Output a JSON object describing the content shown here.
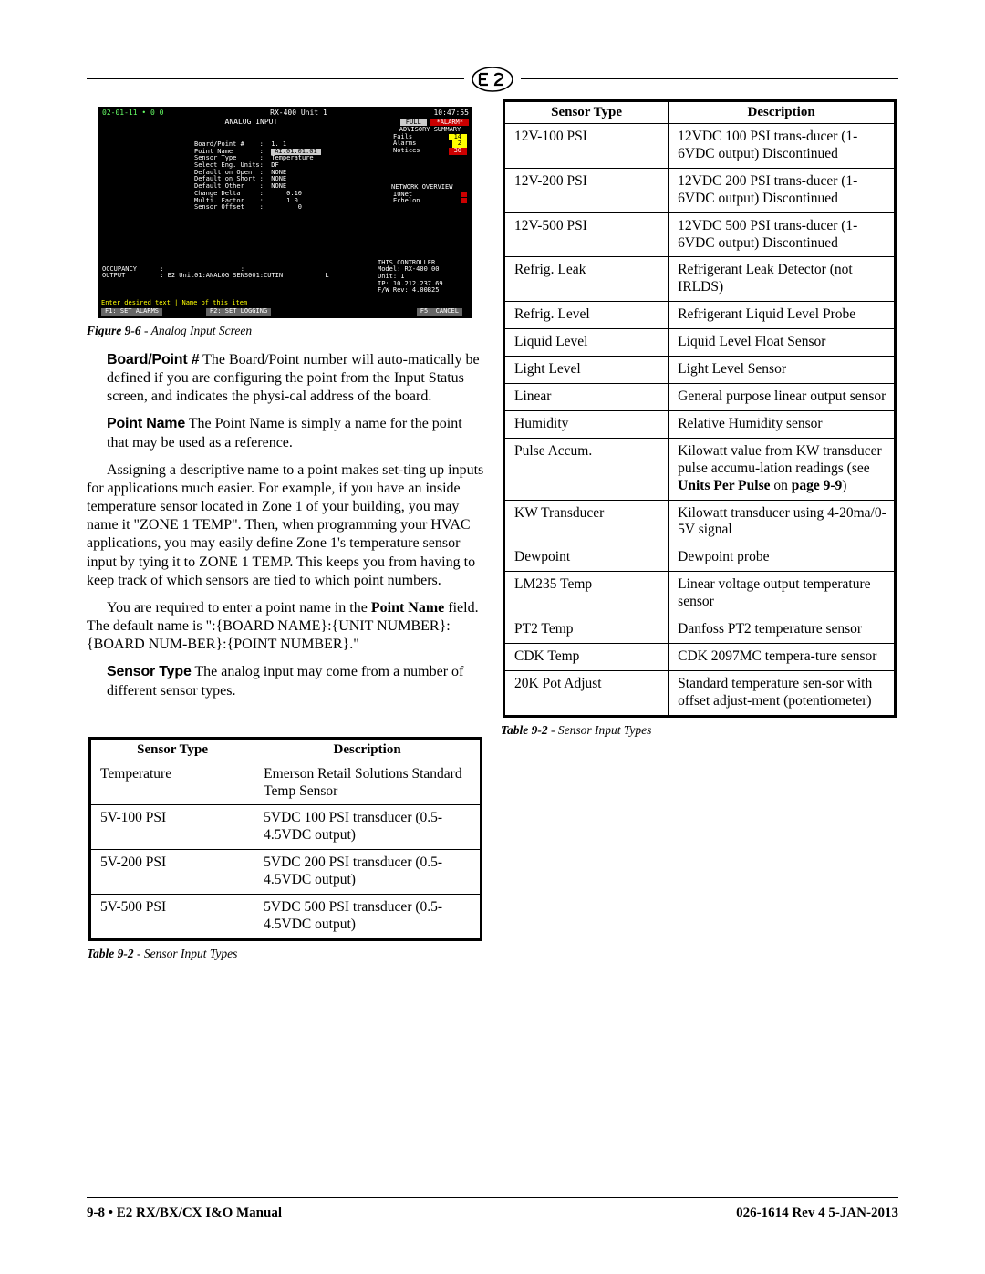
{
  "header": {
    "logo_text": "E2"
  },
  "screenshot": {
    "top_left": "02-01-11 • 0 0",
    "top_mid": "RX-400 Unit 1",
    "top_right": "10:47:55",
    "analog_title": "ANALOG INPUT",
    "full": "FULL",
    "oalarm": "*ALARM*",
    "advisory": "ADVISORY SUMMARY",
    "adv_rows": [
      {
        "l": "Fails",
        "v": "14"
      },
      {
        "l": "Alarms",
        "v": "2"
      },
      {
        "l": "Notices",
        "v": "30"
      }
    ],
    "fields": [
      "Board/Point #    :  1. 1",
      "Point Name       :  ",
      "Sensor Type      :  Temperature",
      "Select Eng. Units:  DF",
      "Default on Open  :  NONE",
      "Default on Short :  NONE",
      "Default Other    :  NONE",
      "Change Delta     :      0.10",
      "",
      "Multi. Factor    :      1.0",
      "Sensor Offset    :         0"
    ],
    "point_name_val": "AI.01.01.01",
    "net_over_title": "NETWORK OVERVIEW",
    "net_rows": [
      {
        "l": "IONet"
      },
      {
        "l": "Echelon"
      }
    ],
    "controller_title": "THIS CONTROLLER",
    "controller_rows": [
      "Model: RX-400    00",
      "Unit: 1",
      "IP: 10.212.237.69",
      "F/W Rev: 4.00B25"
    ],
    "occ_rows": [
      "OCCUPANCY      :                    :",
      "OUTPUT         : E2 Unit01:ANALOG SENS001:CUTIN           L"
    ],
    "enter": "Enter desired text | Name of this item",
    "fkeys": [
      "F1: SET ALARMS",
      "F2: SET LOGGING",
      "",
      "",
      "F5: CANCEL"
    ]
  },
  "fig_caption": {
    "label": "Figure 9-6",
    "title": " - Analog Input Screen"
  },
  "paras": {
    "board_point_lead": "Board/Point #",
    "board_point": "   The Board/Point number will auto-matically be defined if you are configuring the point from the Input Status screen, and indicates the physi-cal address of the board.",
    "point_name_lead": "Point Name",
    "point_name": "   The Point Name is simply a name for the point that may be used as a reference.",
    "assign": "Assigning a descriptive name to a point makes set-ting up inputs for applications much easier. For example, if you have an inside temperature sensor located in Zone 1 of your building, you may name it \"ZONE 1 TEMP\". Then, when programming your HVAC applications, you may easily define Zone 1's temperature sensor input by tying it to ZONE 1 TEMP. This keeps you from having to keep track of which sensors are tied to which point numbers.",
    "required1": "You are required to enter a point name in the ",
    "required_b1": "Point Name",
    "required2": " field. The default name is \":{BOARD NAME}:{UNIT NUMBER}:{BOARD NUM-BER}:{POINT NUMBER}.\"",
    "sensor_type_lead": "Sensor Type",
    "sensor_type": "   The analog input may come from a number of different sensor types."
  },
  "table_header": {
    "col1": "Sensor Type",
    "col2": "Description"
  },
  "table1_rows": [
    {
      "type": "Temperature",
      "desc": "Emerson Retail Solutions Standard Temp Sensor"
    },
    {
      "type": "5V-100 PSI",
      "desc": "5VDC 100 PSI transducer (0.5-4.5VDC output)"
    },
    {
      "type": "5V-200 PSI",
      "desc": "5VDC 200 PSI transducer (0.5-4.5VDC output)"
    },
    {
      "type": "5V-500 PSI",
      "desc": "5VDC 500 PSI transducer (0.5-4.5VDC output)"
    }
  ],
  "table2_rows": [
    {
      "type": "12V-100 PSI",
      "desc": "12VDC 100 PSI trans-ducer (1-6VDC output) Discontinued"
    },
    {
      "type": "12V-200 PSI",
      "desc": "12VDC 200 PSI trans-ducer (1-6VDC output) Discontinued"
    },
    {
      "type": "12V-500 PSI",
      "desc": "12VDC 500 PSI trans-ducer (1-6VDC output) Discontinued"
    },
    {
      "type": "Refrig. Leak",
      "desc": "Refrigerant Leak Detector (not IRLDS)"
    },
    {
      "type": "Refrig. Level",
      "desc": "Refrigerant Liquid Level Probe"
    },
    {
      "type": "Liquid Level",
      "desc": "Liquid Level Float Sensor"
    },
    {
      "type": "Light Level",
      "desc": "Light Level Sensor"
    },
    {
      "type": "Linear",
      "desc": "General purpose linear output sensor"
    },
    {
      "type": "Humidity",
      "desc": "Relative Humidity sensor"
    },
    {
      "type": "Pulse Accum.",
      "desc_html": true,
      "desc": "Kilowatt value from KW transducer pulse accumu-lation readings (see <b>Units Per Pulse</b> on <b>page 9-9</b>)"
    },
    {
      "type": "KW Transducer",
      "desc": "Kilowatt transducer using 4-20ma/0-5V signal"
    },
    {
      "type": "Dewpoint",
      "desc": "Dewpoint probe"
    },
    {
      "type": "LM235 Temp",
      "desc": "Linear voltage output temperature sensor"
    },
    {
      "type": "PT2 Temp",
      "desc": "Danfoss PT2 temperature sensor"
    },
    {
      "type": "CDK Temp",
      "desc": "CDK 2097MC tempera-ture sensor"
    },
    {
      "type": "20K Pot Adjust",
      "desc": "Standard temperature sen-sor with offset adjust-ment (potentiometer)"
    }
  ],
  "table_caption": {
    "label": "Table 9-2",
    "title": " - Sensor Input Types"
  },
  "footer": {
    "left": "9-8 • E2 RX/BX/CX I&O Manual",
    "right": "026-1614 Rev 4 5-JAN-2013"
  }
}
